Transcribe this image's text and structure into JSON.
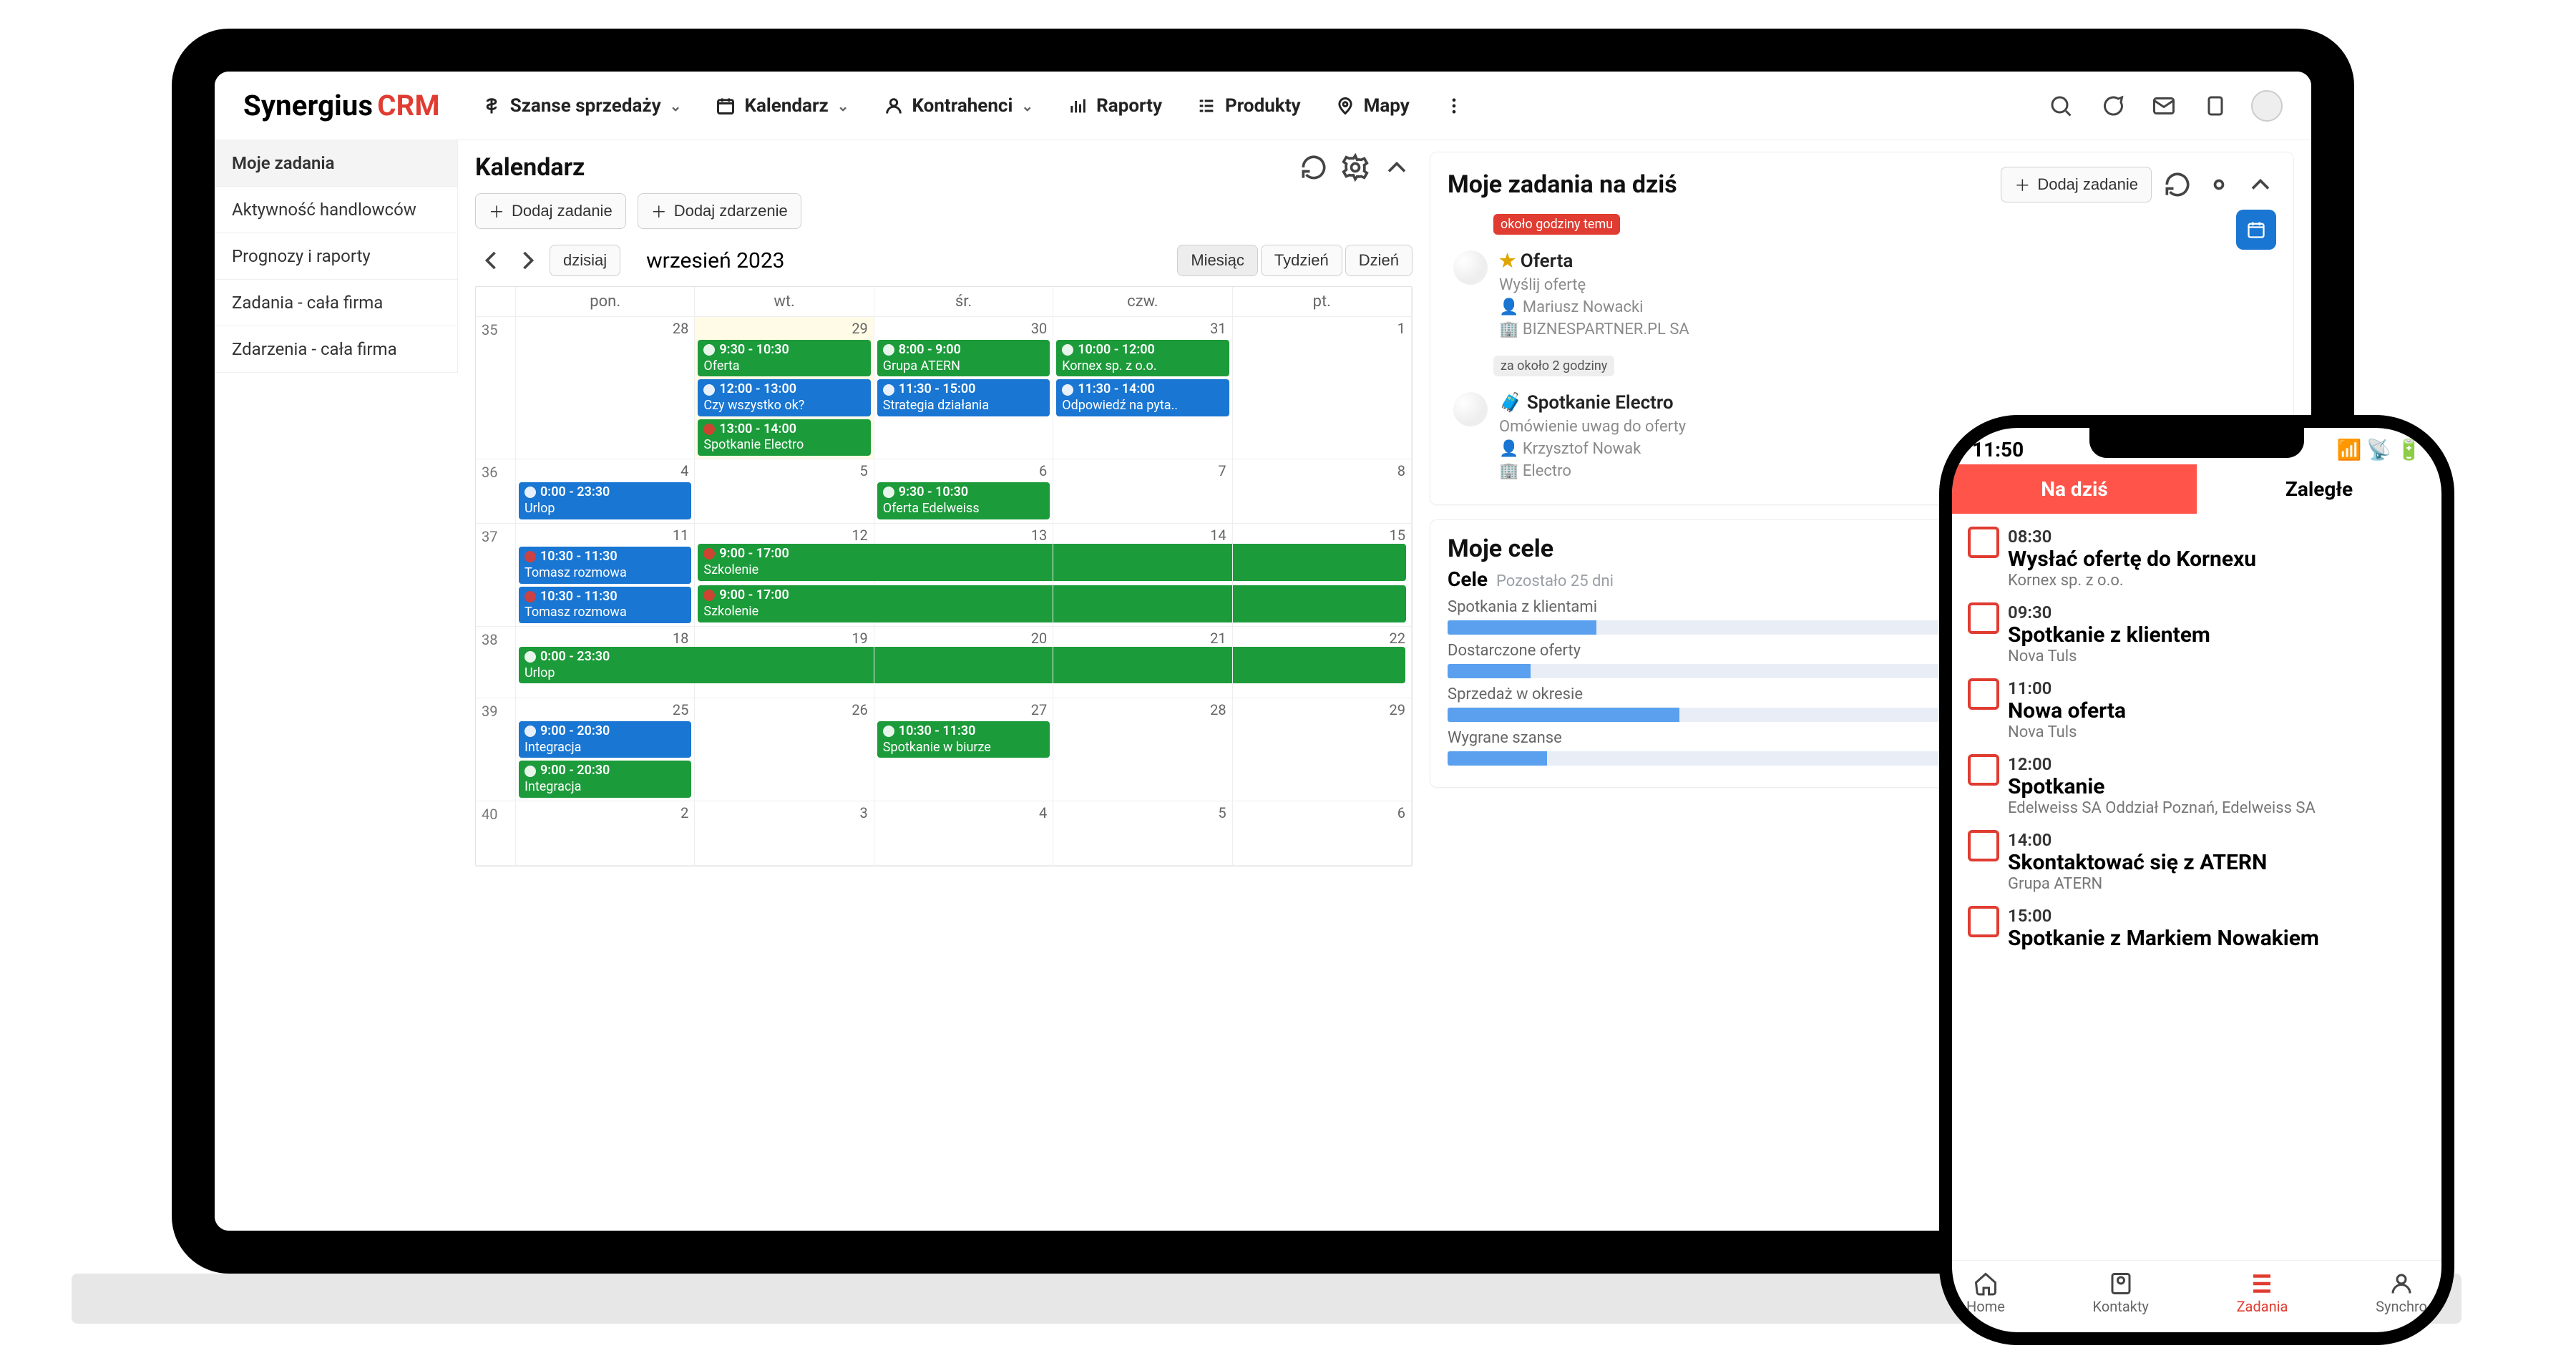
{
  "brand": {
    "name": "Synergius",
    "suffix": "CRM"
  },
  "nav": {
    "sales": "Szanse sprzedaży",
    "calendar": "Kalendarz",
    "contractors": "Kontrahenci",
    "reports": "Raporty",
    "products": "Produkty",
    "maps": "Mapy"
  },
  "sidebar": {
    "items": [
      "Moje zadania",
      "Aktywność handlowców",
      "Prognozy i raporty",
      "Zadania - cała firma",
      "Zdarzenia - cała firma"
    ]
  },
  "calendar": {
    "title": "Kalendarz",
    "addTask": "Dodaj zadanie",
    "addEvent": "Dodaj zdarzenie",
    "today": "dzisiaj",
    "monthLabel": "wrzesień 2023",
    "views": {
      "month": "Miesiąc",
      "week": "Tydzień",
      "day": "Dzień"
    },
    "dow": {
      "mon": "pon.",
      "tue": "wt.",
      "wed": "śr.",
      "thu": "czw.",
      "fri": "pt."
    },
    "weeks": [
      "35",
      "36",
      "37",
      "38",
      "39",
      "40"
    ],
    "days": {
      "w35": [
        "28",
        "29",
        "30",
        "31",
        "1"
      ],
      "w36": [
        "4",
        "5",
        "6",
        "7",
        "8"
      ],
      "w37": [
        "11",
        "12",
        "13",
        "14",
        "15"
      ],
      "w38": [
        "18",
        "19",
        "20",
        "21",
        "22"
      ],
      "w39": [
        "25",
        "26",
        "27",
        "28",
        "29"
      ],
      "w40": [
        "2",
        "3",
        "4",
        "5",
        "6"
      ]
    },
    "chips": {
      "w35_tue": [
        {
          "time": "9:30 - 10:30",
          "text": "Oferta",
          "color": "green"
        },
        {
          "time": "12:00 - 13:00",
          "text": "Czy wszystko ok?",
          "color": "blue"
        },
        {
          "time": "13:00 - 14:00",
          "text": "Spotkanie Electro",
          "color": "green",
          "variant": "red-dot"
        }
      ],
      "w35_wed": [
        {
          "time": "8:00 - 9:00",
          "text": "Grupa ATERN",
          "color": "green"
        },
        {
          "time": "11:30 - 15:00",
          "text": "Strategia działania",
          "color": "blue"
        }
      ],
      "w35_thu": [
        {
          "time": "10:00 - 12:00",
          "text": "Kornex sp. z o.o.",
          "color": "green"
        },
        {
          "time": "11:30 - 14:00",
          "text": "Odpowiedź na pyta..",
          "color": "blue"
        }
      ],
      "w36_mon": [
        {
          "time": "0:00 - 23:30",
          "text": "Urlop",
          "color": "blue"
        }
      ],
      "w36_wed": [
        {
          "time": "9:30 - 10:30",
          "text": "Oferta Edelweiss",
          "color": "green"
        }
      ],
      "w37_mon": [
        {
          "time": "10:30 - 11:30",
          "text": "Tomasz rozmowa",
          "color": "blue",
          "variant": "red-dot"
        },
        {
          "time": "10:30 - 11:30",
          "text": "Tomasz rozmowa",
          "color": "blue",
          "variant": "red-dot"
        }
      ],
      "w37_tue": [
        {
          "time": "9:00 - 17:00",
          "text": "Szkolenie",
          "color": "green",
          "span": 4
        },
        {
          "time": "9:00 - 17:00",
          "text": "Szkolenie",
          "color": "green",
          "span": 4
        }
      ],
      "w38_mon": [
        {
          "time": "0:00 - 23:30",
          "text": "Urlop",
          "color": "green",
          "span": 5
        }
      ],
      "w39_mon": [
        {
          "time": "9:00 - 20:30",
          "text": "Integracja",
          "color": "blue"
        },
        {
          "time": "9:00 - 20:30",
          "text": "Integracja",
          "color": "green"
        }
      ],
      "w39_wed": [
        {
          "time": "10:30 - 11:30",
          "text": "Spotkanie w biurze",
          "color": "green"
        }
      ]
    }
  },
  "tasks": {
    "title": "Moje zadania na dziś",
    "addTask": "Dodaj zadanie",
    "items": [
      {
        "badge": "około godziny temu",
        "icon": "star",
        "title": "Oferta",
        "line1": "Wyślij ofertę",
        "person": "Mariusz Nowacki",
        "company": "BIZNESPARTNER.PL SA"
      },
      {
        "badge": "za około 2 godziny",
        "icon": "briefcase",
        "title": "Spotkanie Electro",
        "line1": "Omówienie uwag do oferty",
        "person": "Krzysztof Nowak",
        "company": "Electro"
      }
    ]
  },
  "goals": {
    "title": "Moje cele",
    "subtitle": "Cele",
    "remain": "Pozostało 25 dni",
    "rows": [
      {
        "label": "Spotkania z klientami",
        "pct": 18
      },
      {
        "label": "Dostarczone oferty",
        "pct": 10
      },
      {
        "label": "Sprzedaż w okresie",
        "pct": 28
      },
      {
        "label": "Wygrane szanse",
        "pct": 12
      }
    ]
  },
  "phone": {
    "time": "11:50",
    "tabs": {
      "today": "Na dziś",
      "over": "Zaległe"
    },
    "items": [
      {
        "time": "08:30",
        "title": "Wysłać ofertę do Kornexu",
        "sub": "Kornex sp. z o.o."
      },
      {
        "time": "09:30",
        "title": "Spotkanie z klientem",
        "sub": "Nova Tuls"
      },
      {
        "time": "11:00",
        "title": "Nowa oferta",
        "sub": "Nova Tuls"
      },
      {
        "time": "12:00",
        "title": "Spotkanie",
        "sub": "Edelweiss SA Oddział Poznań, Edelweiss SA"
      },
      {
        "time": "14:00",
        "title": "Skontaktować się z ATERN",
        "sub": "Grupa ATERN"
      },
      {
        "time": "15:00",
        "title": "Spotkanie z Markiem Nowakiem",
        "sub": ""
      }
    ],
    "bnav": {
      "home": "Home",
      "contacts": "Kontakty",
      "tasks": "Zadania",
      "sync": "Synchro"
    }
  },
  "chart_data": [
    {
      "type": "bar",
      "title": "Spotkania z klientami",
      "categories": [
        "progress"
      ],
      "values": [
        18
      ],
      "ylim": [
        0,
        100
      ]
    },
    {
      "type": "bar",
      "title": "Dostarczone oferty",
      "categories": [
        "progress"
      ],
      "values": [
        10
      ],
      "ylim": [
        0,
        100
      ]
    },
    {
      "type": "bar",
      "title": "Sprzedaż w okresie",
      "categories": [
        "progress"
      ],
      "values": [
        28
      ],
      "ylim": [
        0,
        100
      ]
    },
    {
      "type": "bar",
      "title": "Wygrane szanse",
      "categories": [
        "progress"
      ],
      "values": [
        12
      ],
      "ylim": [
        0,
        100
      ]
    }
  ]
}
